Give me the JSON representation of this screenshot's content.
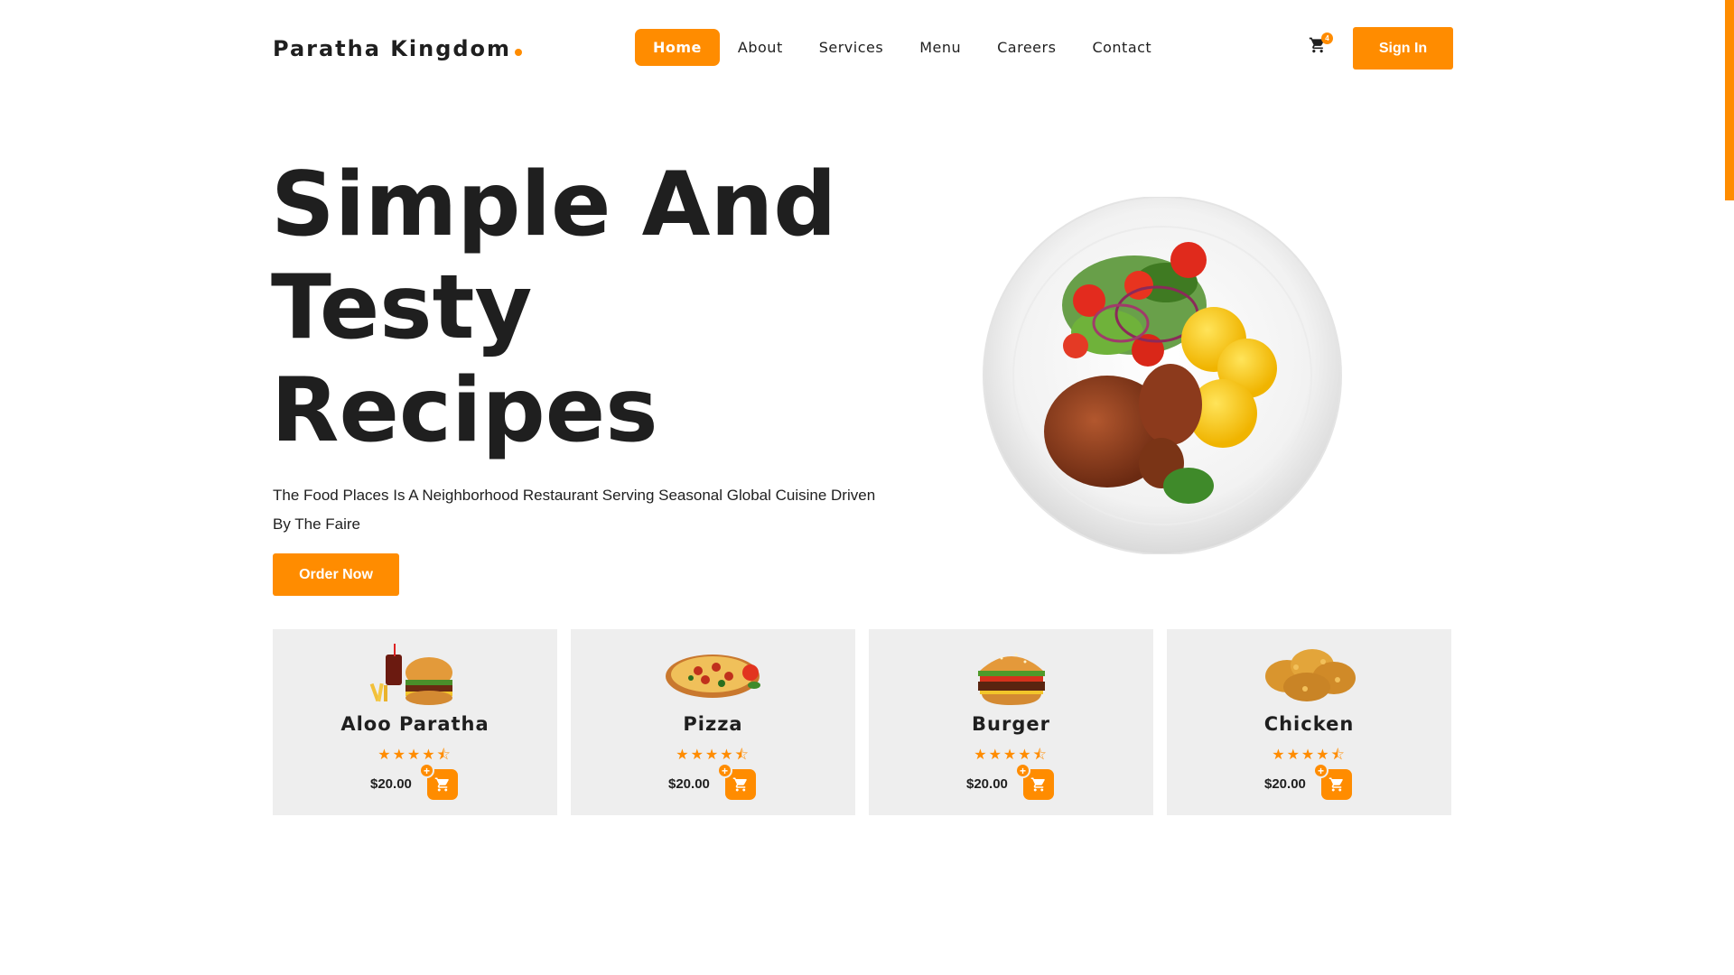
{
  "brand": {
    "name": "Paratha Kingdom",
    "accent": "#ff8c00"
  },
  "nav": {
    "items": [
      {
        "label": "Home",
        "active": true
      },
      {
        "label": "About"
      },
      {
        "label": "Services"
      },
      {
        "label": "Menu"
      },
      {
        "label": "Careers"
      },
      {
        "label": "Contact"
      }
    ],
    "cart_count": "4",
    "cart_icon": "cart-icon",
    "signin_label": "Sign In"
  },
  "hero": {
    "title_lines": [
      "Simple And",
      "Testy",
      "Recipes"
    ],
    "subtitle": "The Food Places Is A Neighborhood Restaurant Serving Seasonal Global Cuisine Driven By The Faire",
    "order_label": "Order Now",
    "image": "plate-of-grilled-meat-salad-potatoes"
  },
  "cards": [
    {
      "name": "Aloo Paratha",
      "rating": 4.5,
      "price": "$20.00",
      "image": "burger-fries-drink"
    },
    {
      "name": "Pizza",
      "rating": 4.5,
      "price": "$20.00",
      "image": "pizza"
    },
    {
      "name": "Burger",
      "rating": 4.5,
      "price": "$20.00",
      "image": "burger"
    },
    {
      "name": "Chicken",
      "rating": 4.5,
      "price": "$20.00",
      "image": "fried-chicken"
    }
  ]
}
